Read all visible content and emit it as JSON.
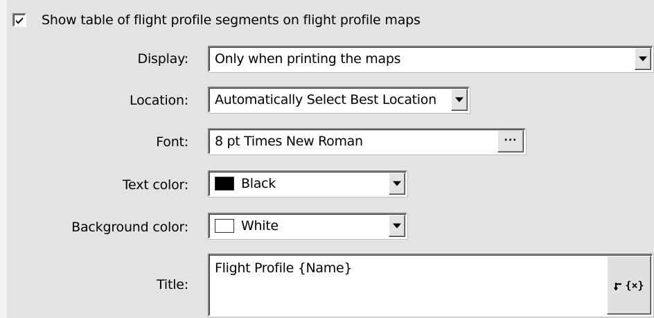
{
  "show_table": {
    "checked": true,
    "label": "Show table of flight profile segments on flight profile maps"
  },
  "display": {
    "label": "Display:",
    "value": "Only when printing the maps"
  },
  "location": {
    "label": "Location:",
    "value": "Automatically Select Best Location"
  },
  "font": {
    "label": "Font:",
    "value": "8 pt Times New Roman",
    "browse_label": "···"
  },
  "text_color": {
    "label": "Text color:",
    "value": "Black",
    "swatch_color": "#000000"
  },
  "background_color": {
    "label": "Background color:",
    "value": "White",
    "swatch_color": "#ffffff"
  },
  "title": {
    "label": "Title:",
    "value": "Flight Profile {Name}",
    "insert_variable_label": "{×}",
    "insert_icon": "insert-arrow-icon"
  },
  "colors": {
    "panel_bg": "#e3e3e3",
    "field_bg": "#ffffff"
  }
}
